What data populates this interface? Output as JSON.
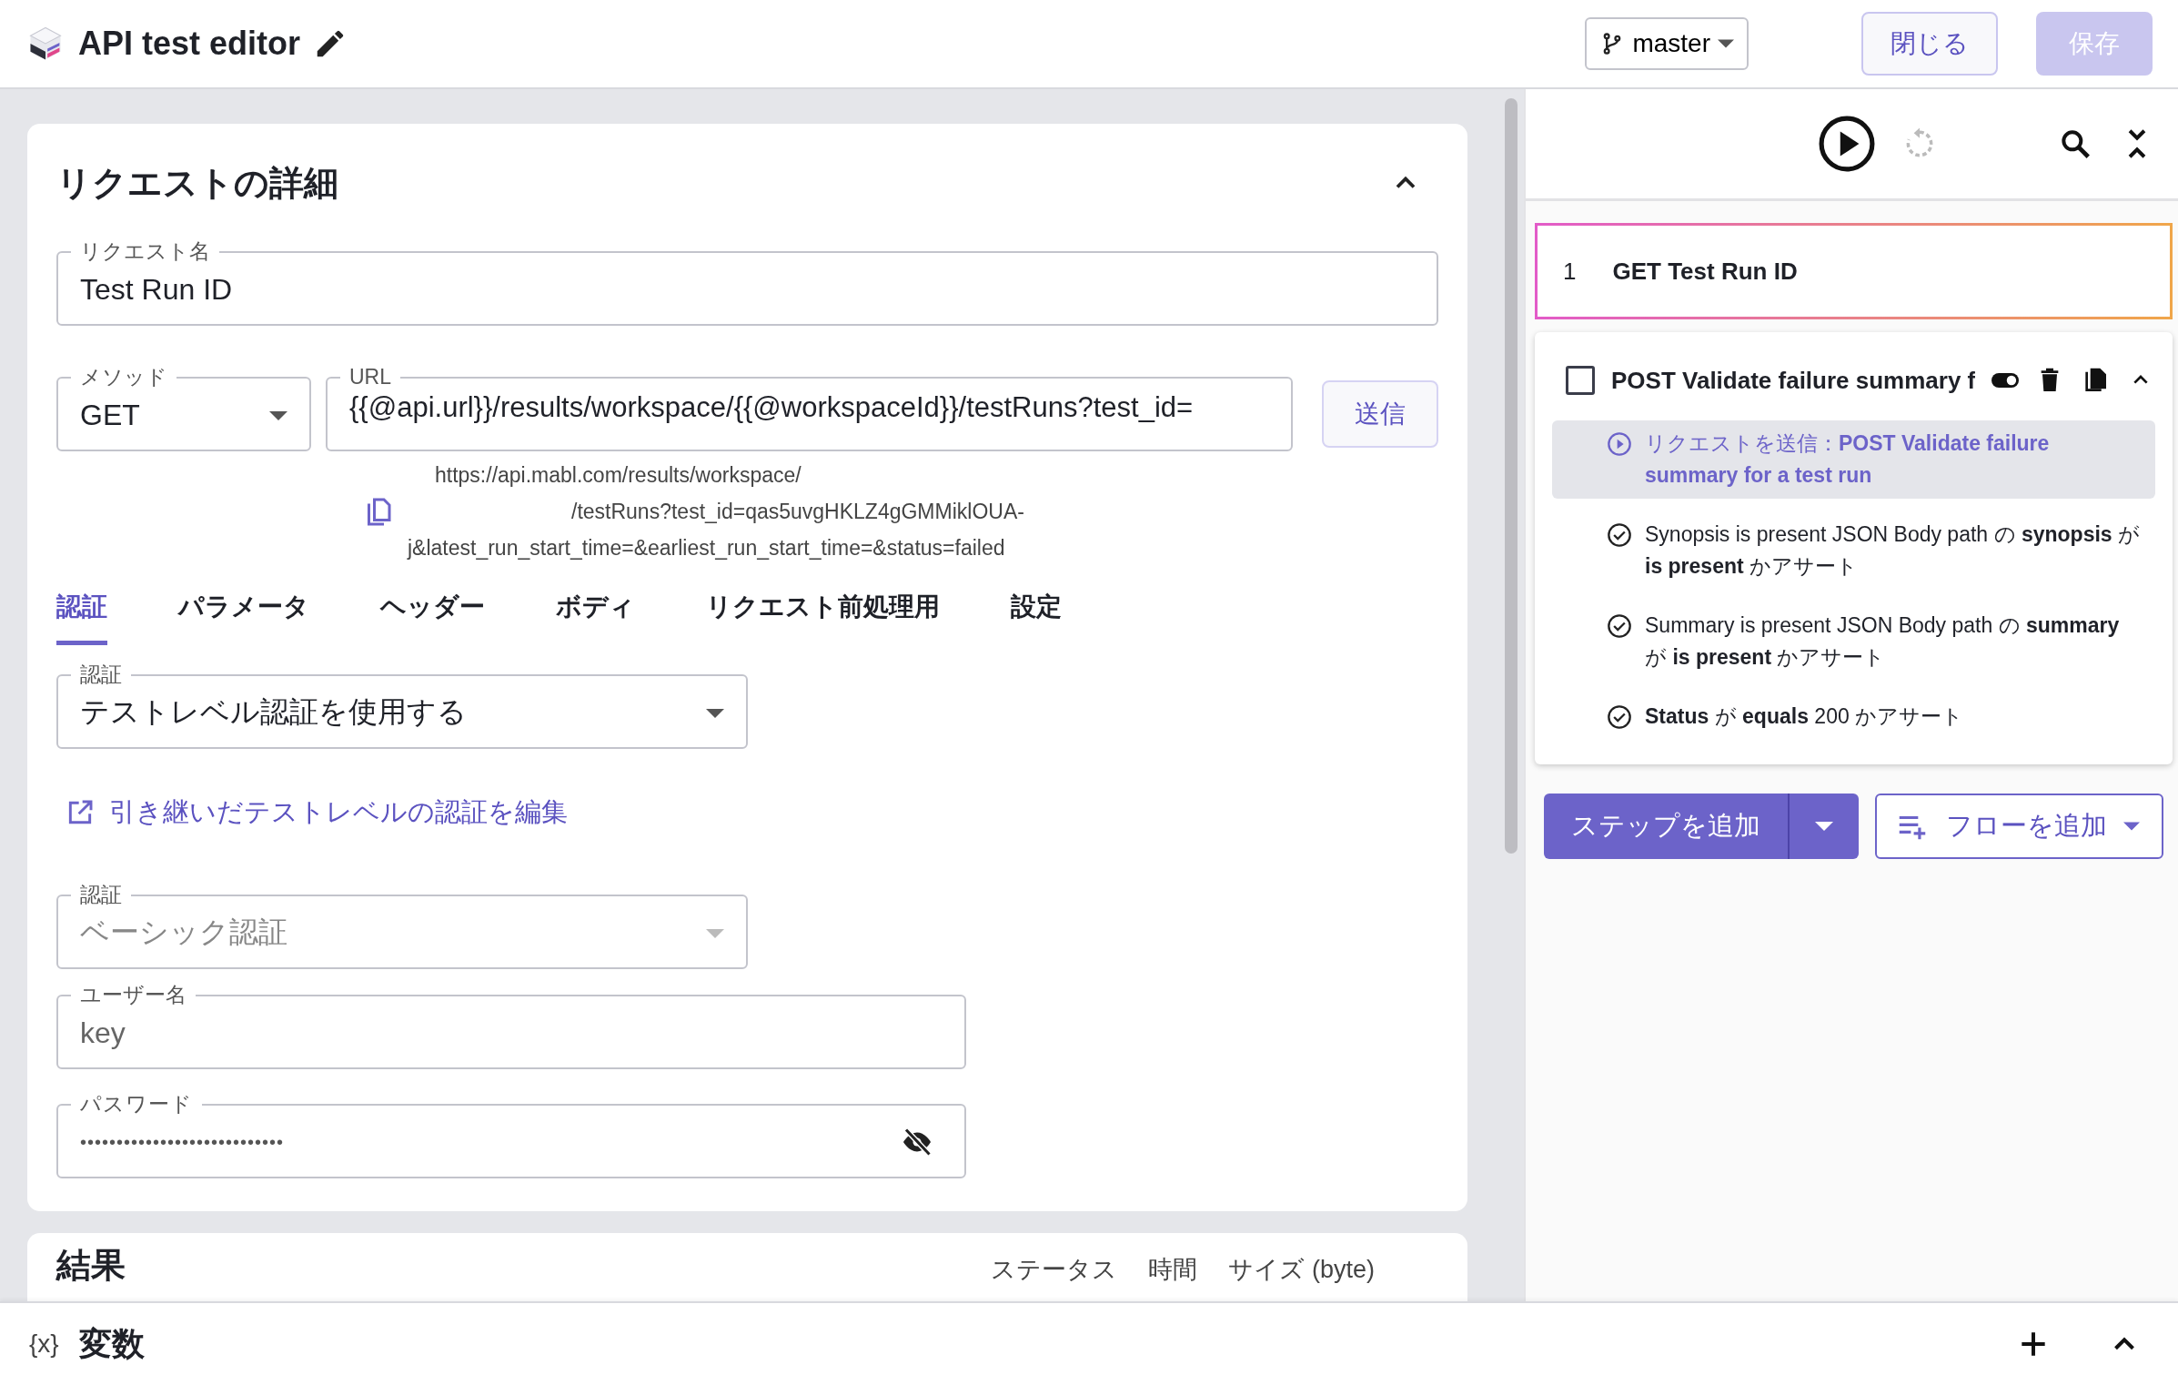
{
  "app": {
    "title": "API test editor",
    "branch": "master",
    "close_button": "閉じる",
    "save_button": "保存",
    "save_disabled": true
  },
  "request": {
    "heading": "リクエストの詳細",
    "expanded": true,
    "name_field": {
      "label": "リクエスト名",
      "value": "Test Run ID"
    },
    "method_field": {
      "label": "メソッド",
      "value": "GET"
    },
    "url_field": {
      "label": "URL",
      "value": "{{@api.url}}/results/workspace/{{@workspaceId}}/testRuns?test_id="
    },
    "send_button": "送信",
    "resolved_url": [
      "https://api.mabl.com/results/workspace/",
      "/testRuns?test_id=qas5uvgHKLZ4gGMMiklOUA-",
      "j&latest_run_start_time=&earliest_run_start_time=&status=failed"
    ],
    "tabs": [
      {
        "label": "認証",
        "selected": true
      },
      {
        "label": "パラメータ",
        "selected": false
      },
      {
        "label": "ヘッダー",
        "selected": false
      },
      {
        "label": "ボディ",
        "selected": false
      },
      {
        "label": "リクエスト前処理用",
        "selected": false
      },
      {
        "label": "設定",
        "selected": false
      }
    ],
    "auth_field": {
      "label": "認証",
      "value": "テストレベル認証を使用する",
      "disabled": false
    },
    "edit_link": "引き継いだテストレベルの認証を編集",
    "auth_type_field": {
      "label": "認証",
      "value": "ベーシック認証",
      "disabled": true
    },
    "username_field": {
      "label": "ユーザー名",
      "value": "key"
    },
    "password_field": {
      "label": "パスワード",
      "value": "••••••••••••••••••••••••••••"
    }
  },
  "results": {
    "heading": "結果",
    "columns": [
      "ステータス",
      "時間",
      "サイズ (byte)"
    ]
  },
  "steps": [
    {
      "number": "1",
      "title": "GET Test Run ID",
      "selected": true
    },
    {
      "title": "POST Validate failure summary f",
      "selected": false,
      "checked": false,
      "expanded": true,
      "children": [
        {
          "kind": "request",
          "text": "リクエストを送信：**POST Validate failure summary for a test run**",
          "selected": true
        },
        {
          "kind": "assertion",
          "text": "Synopsis is present JSON Body path の **synopsis** が **is present** かアサート",
          "selected": false
        },
        {
          "kind": "assertion",
          "text": "Summary is present JSON Body path の **summary** が **is present** かアサート",
          "selected": false
        },
        {
          "kind": "assertion",
          "text": "**Status** が **equals** 200 かアサート",
          "selected": false
        }
      ]
    }
  ],
  "add_step_button": "ステップを追加",
  "add_flow_button": "フローを追加",
  "variables_bar": {
    "icon_text": "{x}",
    "title": "変数"
  }
}
